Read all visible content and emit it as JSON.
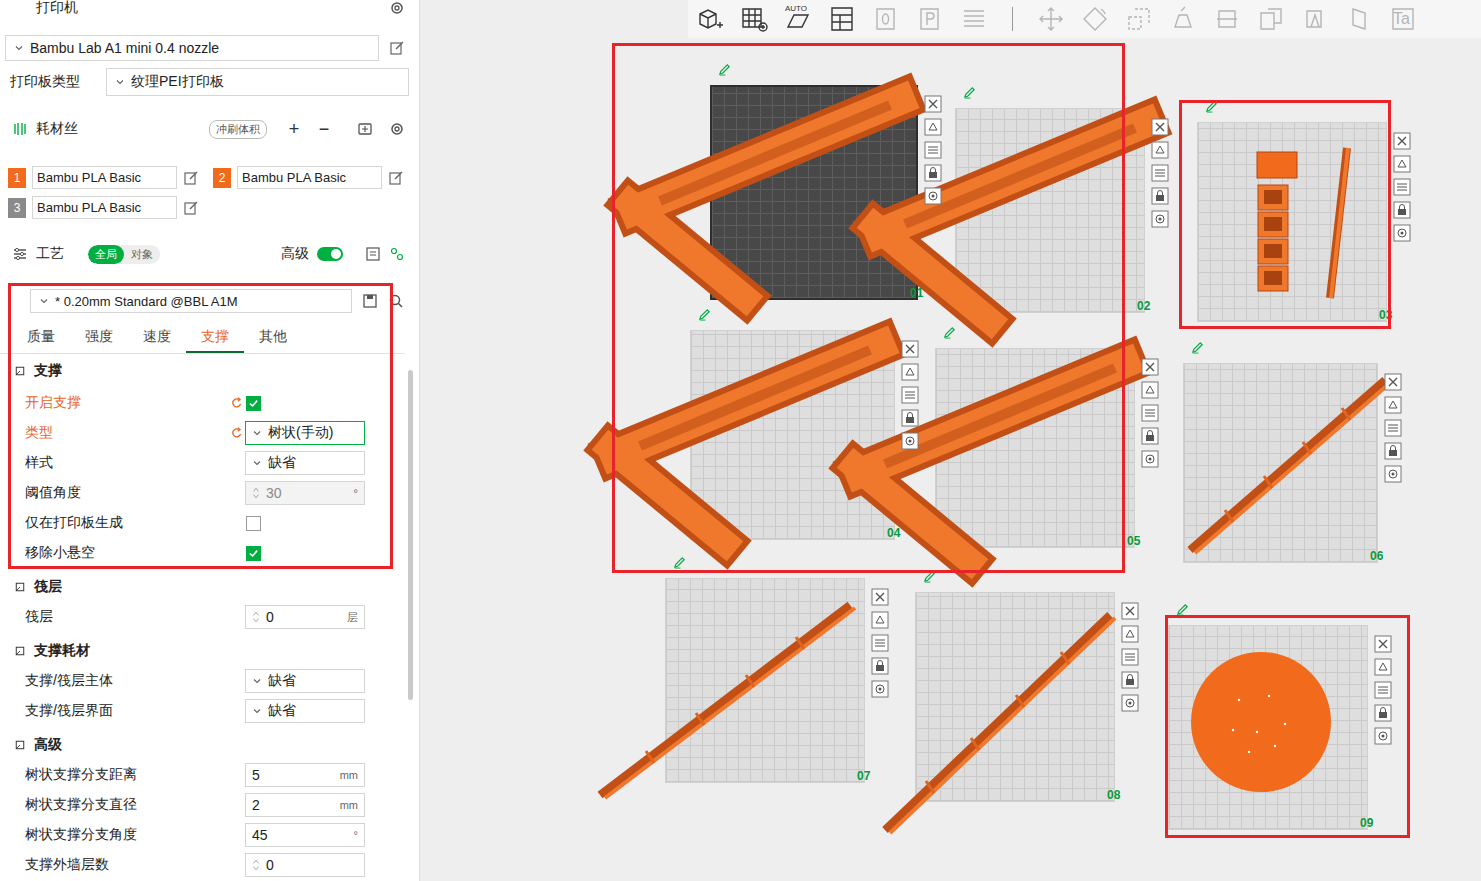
{
  "printer": {
    "title": "打印机",
    "name": "Bambu Lab A1 mini 0.4 nozzle",
    "plate_type_label": "打印板类型",
    "plate_type": "纹理PEI打印板"
  },
  "filament": {
    "title": "耗材丝",
    "badge": "冲刷体积",
    "add": "+",
    "remove": "−",
    "items": [
      {
        "number": "1",
        "name": "Bambu PLA Basic",
        "color": "#f26b1d"
      },
      {
        "number": "2",
        "name": "Bambu PLA Basic",
        "color": "#f26b1d"
      },
      {
        "number": "3",
        "name": "Bambu PLA Basic",
        "color": "#8a8a8a"
      }
    ]
  },
  "process": {
    "title": "工艺",
    "scope": [
      {
        "label": "全局",
        "selected": true
      },
      {
        "label": "对象",
        "selected": false
      }
    ],
    "advanced_label": "高级",
    "advanced_on": true,
    "preset": "* 0.20mm Standard @BBL A1M",
    "highlighted": true,
    "tabs": [
      {
        "label": "质量",
        "selected": false
      },
      {
        "label": "强度",
        "selected": false
      },
      {
        "label": "速度",
        "selected": false
      },
      {
        "label": "支撑",
        "selected": true
      },
      {
        "label": "其他",
        "selected": false
      }
    ],
    "sections": [
      {
        "title": "支撑",
        "rows": [
          {
            "label": "开启支撑",
            "kind": "checkbox",
            "checked": true,
            "modified": true,
            "disabled": false
          },
          {
            "label": "类型",
            "kind": "select",
            "value": "树状(手动)",
            "modified": true,
            "disabled": false
          },
          {
            "label": "样式",
            "kind": "select",
            "value": "缺省",
            "modified": false,
            "disabled": false
          },
          {
            "label": "阈值角度",
            "kind": "spin",
            "value": "30",
            "unit": "°",
            "modified": false,
            "disabled": true
          },
          {
            "label": "仅在打印板生成",
            "kind": "checkbox",
            "checked": false,
            "modified": false,
            "disabled": false
          },
          {
            "label": "移除小悬空",
            "kind": "checkbox",
            "checked": true,
            "modified": false,
            "disabled": false
          }
        ]
      },
      {
        "title": "筏层",
        "rows": [
          {
            "label": "筏层",
            "kind": "spin",
            "value": "0",
            "unit": "层",
            "modified": false,
            "disabled": false
          }
        ]
      },
      {
        "title": "支撑耗材",
        "rows": [
          {
            "label": "支撑/筏层主体",
            "kind": "select",
            "value": "缺省",
            "modified": false,
            "disabled": false
          },
          {
            "label": "支撑/筏层界面",
            "kind": "select",
            "value": "缺省",
            "modified": false,
            "disabled": false
          }
        ]
      },
      {
        "title": "高级",
        "rows": [
          {
            "label": "树状支撑分支距离",
            "kind": "input",
            "value": "5",
            "unit": "mm",
            "modified": false,
            "disabled": false
          },
          {
            "label": "树状支撑分支直径",
            "kind": "input",
            "value": "2",
            "unit": "mm",
            "modified": false,
            "disabled": false
          },
          {
            "label": "树状支撑分支角度",
            "kind": "input",
            "value": "45",
            "unit": "°",
            "modified": false,
            "disabled": false
          },
          {
            "label": "支撑外墙层数",
            "kind": "spin",
            "value": "0",
            "unit": "",
            "modified": false,
            "disabled": false
          }
        ]
      }
    ]
  },
  "toolbar": [
    {
      "kind": "add-plate",
      "disabled": false,
      "label": ""
    },
    {
      "kind": "arrange",
      "disabled": false,
      "label": ""
    },
    {
      "kind": "auto-orient",
      "disabled": false,
      "label": "AUTO"
    },
    {
      "kind": "layout",
      "disabled": false,
      "label": ""
    },
    {
      "kind": "plate-o",
      "disabled": true,
      "label": ""
    },
    {
      "kind": "plate-p",
      "disabled": true,
      "label": ""
    },
    {
      "kind": "layers",
      "disabled": true,
      "label": ""
    },
    {
      "kind": "separator",
      "disabled": true,
      "label": ""
    },
    {
      "kind": "move",
      "disabled": true,
      "label": ""
    },
    {
      "kind": "rotate",
      "disabled": true,
      "label": ""
    },
    {
      "kind": "scale",
      "disabled": true,
      "label": ""
    },
    {
      "kind": "lay-face",
      "disabled": true,
      "label": ""
    },
    {
      "kind": "cut",
      "disabled": true,
      "label": ""
    },
    {
      "kind": "boolean",
      "disabled": true,
      "label": ""
    },
    {
      "kind": "paint",
      "disabled": true,
      "label": ""
    },
    {
      "kind": "seam",
      "disabled": true,
      "label": ""
    },
    {
      "kind": "text",
      "disabled": true,
      "label": "Ta"
    }
  ],
  "canvas": {
    "plates": [
      {
        "number": "01",
        "selected": true,
        "model": "trough"
      },
      {
        "number": "02",
        "selected": false,
        "model": "trough"
      },
      {
        "number": "03",
        "selected": false,
        "model": "parts"
      },
      {
        "number": "04",
        "selected": false,
        "model": "trough"
      },
      {
        "number": "05",
        "selected": false,
        "model": "trough"
      },
      {
        "number": "06",
        "selected": false,
        "model": "rod"
      },
      {
        "number": "07",
        "selected": false,
        "model": "rod"
      },
      {
        "number": "08",
        "selected": false,
        "model": "rod"
      },
      {
        "number": "09",
        "selected": false,
        "model": "disc"
      }
    ],
    "highlights": [
      {
        "covers": [
          "01",
          "02",
          "04",
          "05"
        ]
      },
      {
        "covers": [
          "03"
        ]
      },
      {
        "covers": [
          "09"
        ]
      }
    ]
  }
}
